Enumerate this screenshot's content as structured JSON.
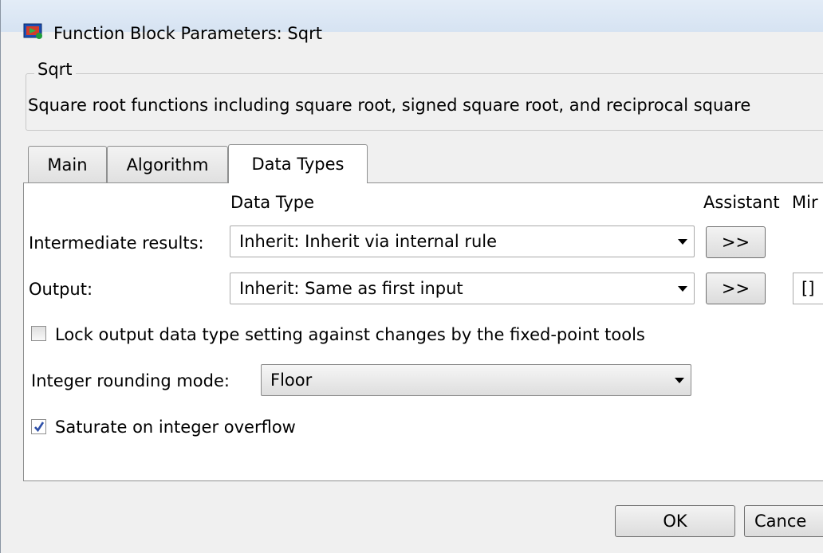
{
  "window": {
    "title": "Function Block Parameters: Sqrt",
    "icon": "simulink-block-icon"
  },
  "group": {
    "legend": "Sqrt",
    "description": "Square root functions including square root, signed square root, and reciprocal square"
  },
  "tabs": [
    {
      "label": "Main",
      "active": false
    },
    {
      "label": "Algorithm",
      "active": false
    },
    {
      "label": "Data Types",
      "active": true
    }
  ],
  "data_types": {
    "col_data_type": "Data Type",
    "col_assistant": "Assistant",
    "col_min": "Mir",
    "intermediate": {
      "label": "Intermediate results:",
      "value": "Inherit: Inherit via internal rule",
      "assistant_label": ">>"
    },
    "output": {
      "label": "Output:",
      "value": "Inherit: Same as first input",
      "assistant_label": ">>",
      "min_value": "[]"
    },
    "lock": {
      "label": "Lock output data type setting against changes by the fixed-point tools",
      "checked": false
    },
    "rounding": {
      "label": "Integer rounding mode:",
      "value": "Floor"
    },
    "saturate": {
      "label": "Saturate on integer overflow",
      "checked": true
    }
  },
  "buttons": {
    "ok": "OK",
    "cancel": "Cance"
  }
}
